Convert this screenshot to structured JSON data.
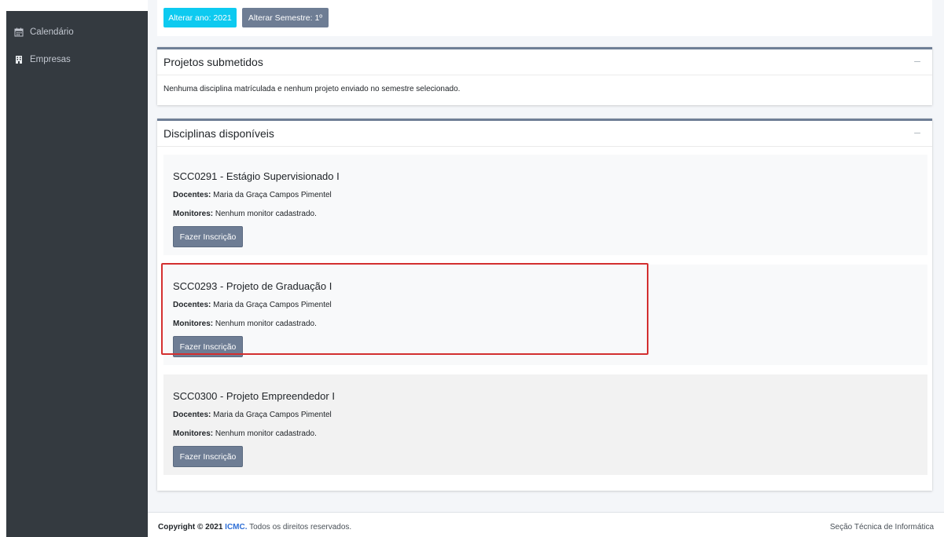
{
  "sidebar": {
    "items": [
      {
        "label": "Calendário",
        "icon": "calendar-icon"
      },
      {
        "label": "Empresas",
        "icon": "building-icon"
      }
    ]
  },
  "toolbar": {
    "year_button": "Alterar ano: 2021",
    "semester_button": "Alterar Semestre: 1º"
  },
  "projetos": {
    "title": "Projetos submetidos",
    "message": "Nenhuma disciplina matrículada e nenhum projeto enviado no semestre selecionado."
  },
  "disciplinas": {
    "title": "Disciplinas disponíveis",
    "docentes_label": "Docentes:",
    "monitores_label": "Monitores:",
    "items": [
      {
        "title": "SCC0291 - Estágio Supervisionado I",
        "docentes": "Maria da Graça Campos Pimentel",
        "monitores": "Nenhum monitor cadastrado.",
        "button": "Fazer Inscrição"
      },
      {
        "title": "SCC0293 - Projeto de Graduação I",
        "docentes": "Maria da Graça Campos Pimentel",
        "monitores": "Nenhum monitor cadastrado.",
        "button": "Fazer Inscrição"
      },
      {
        "title": "SCC0300 - Projeto Empreendedor I",
        "docentes": "Maria da Graça Campos Pimentel",
        "monitores": "Nenhum monitor cadastrado.",
        "button": "Fazer Inscrição"
      }
    ]
  },
  "footer": {
    "copyright_prefix": "Copyright © 2021",
    "org": "ICMC.",
    "rights": "Todos os direitos reservados.",
    "right_text": "Seção Técnica de Informática"
  },
  "colors": {
    "sidebar_bg": "#343a40",
    "accent_info": "#0dcaf0",
    "secondary": "#6c757d",
    "highlight": "#d32f2f"
  }
}
